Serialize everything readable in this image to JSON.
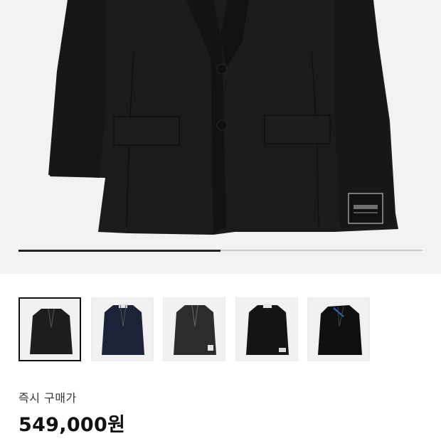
{
  "product": {
    "main_image": {
      "icon": "black-blazer-image",
      "progress": 0.5
    },
    "thumbnails": [
      {
        "icon": "black-blazer-thumbnail",
        "color": "#1e1d1b",
        "selected": true
      },
      {
        "icon": "navy-blazer-thumbnail",
        "color": "#1c2238",
        "selected": false
      },
      {
        "icon": "charcoal-blazer-thumbnail",
        "color": "#2c2c2c",
        "selected": false
      },
      {
        "icon": "black-blazer-thumbnail",
        "color": "#141414",
        "selected": false
      },
      {
        "icon": "black-blazer-thumbnail",
        "color": "#0f0f0f",
        "selected": false
      }
    ],
    "price_label": "즉시 구매가",
    "price": "549,000원"
  },
  "colors": {
    "hero_background": "#f2f2f2",
    "jacket_main": "#1c1b19",
    "progress_active": "#222222",
    "progress_track": "#c9c9c9"
  }
}
